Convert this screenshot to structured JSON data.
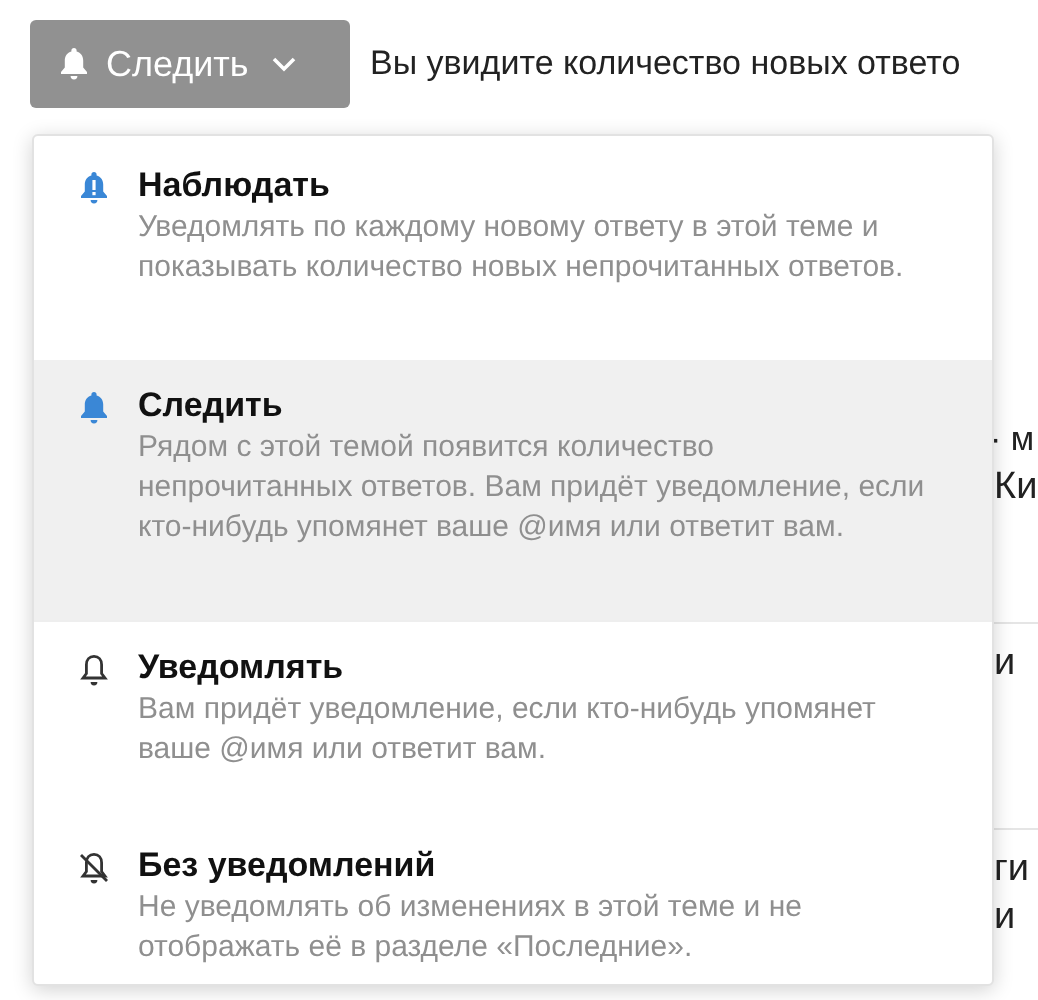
{
  "button": {
    "label": "Следить",
    "kind": "tracking"
  },
  "hint": "Вы увидите количество новых ответо",
  "background_fragments": [
    {
      "lines": [
        "· м",
        "Ки"
      ]
    },
    {
      "lines": [
        "и"
      ]
    },
    {
      "lines": [
        "ги",
        "и"
      ]
    }
  ],
  "menu": {
    "items": [
      {
        "kind": "watching",
        "title": "Наблюдать",
        "description": "Уведомлять по каждому новому ответу в этой теме и показывать количество новых непрочитанных ответов.",
        "selected": false
      },
      {
        "kind": "tracking",
        "title": "Следить",
        "description": "Рядом с этой темой появится количество непрочитанных ответов. Вам придёт уведомление, если кто-нибудь упомянет ваше @имя или ответит вам.",
        "selected": true
      },
      {
        "kind": "regular",
        "title": "Уведомлять",
        "description": "Вам придёт уведомление, если кто-нибудь упомянет ваше @имя или ответит вам.",
        "selected": false
      },
      {
        "kind": "muted",
        "title": "Без уведомлений",
        "description": "Не уведомлять об изменениях в этой теме и не отображать её в разделе «Последние».",
        "selected": false
      }
    ]
  }
}
